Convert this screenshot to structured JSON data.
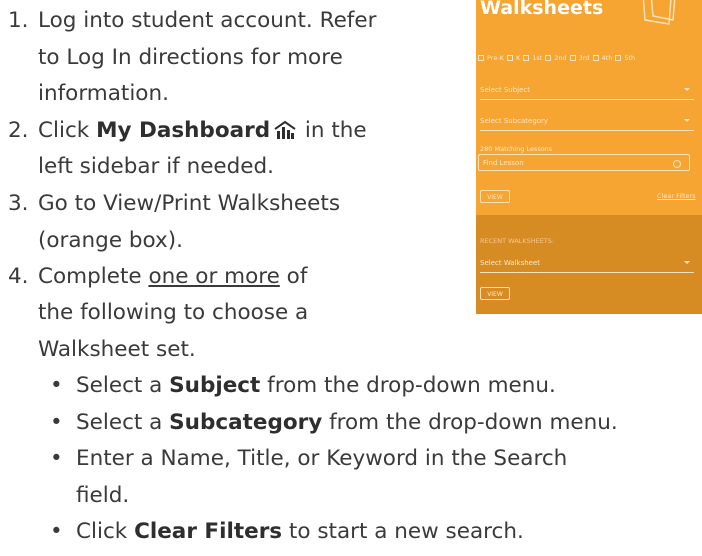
{
  "steps": {
    "s1_num": "1.",
    "s1_line1": "Log into student account. Refer",
    "s1_line2": "to Log In directions for more",
    "s1_line3": "information.",
    "s2_num": "2.",
    "s2_pre": "Click ",
    "s2_bold": "My Dashboard",
    "s2_post": " in the",
    "s2_line2": "left sidebar if needed.",
    "s3_num": "3.",
    "s3_line1": "Go to View/Print Walksheets",
    "s3_line2": "(orange box).",
    "s4_num": "4.",
    "s4_pre": "Complete ",
    "s4_underline": "one or more",
    "s4_post": " of",
    "s4_line2": "the following to choose a",
    "s4_line3": "Walksheet set.",
    "b1_pre": "Select a ",
    "b1_bold": "Subject",
    "b1_post": " from the drop-down menu.",
    "b2_pre": "Select a ",
    "b2_bold": "Subcategory",
    "b2_post": " from the drop-down menu.",
    "b3_line1": "Enter a Name, Title, or Keyword in the Search",
    "b3_line2": "field.",
    "b4_pre": "Click ",
    "b4_bold": "Clear Filters",
    "b4_post": " to start a new search.",
    "bullet": "•"
  },
  "widget": {
    "title": "Walksheets",
    "grades": [
      "Pre-K",
      "K",
      "1st",
      "2nd",
      "3rd",
      "4th",
      "5th"
    ],
    "select_subject": "Select Subject",
    "select_subcategory": "Select Subcategory",
    "matching": "280 Matching Lessons",
    "find_placeholder": "Find Lesson",
    "view_label": "VIEW",
    "clear_filters": "Clear Filters",
    "recent_label": "RECENT WALKSHEETS:",
    "select_walksheet": "Select Walksheet",
    "view2_label": "VIEW"
  },
  "colors": {
    "orange": "#f6a432",
    "dark_orange": "#d78b23",
    "text": "#3a3a3a"
  }
}
